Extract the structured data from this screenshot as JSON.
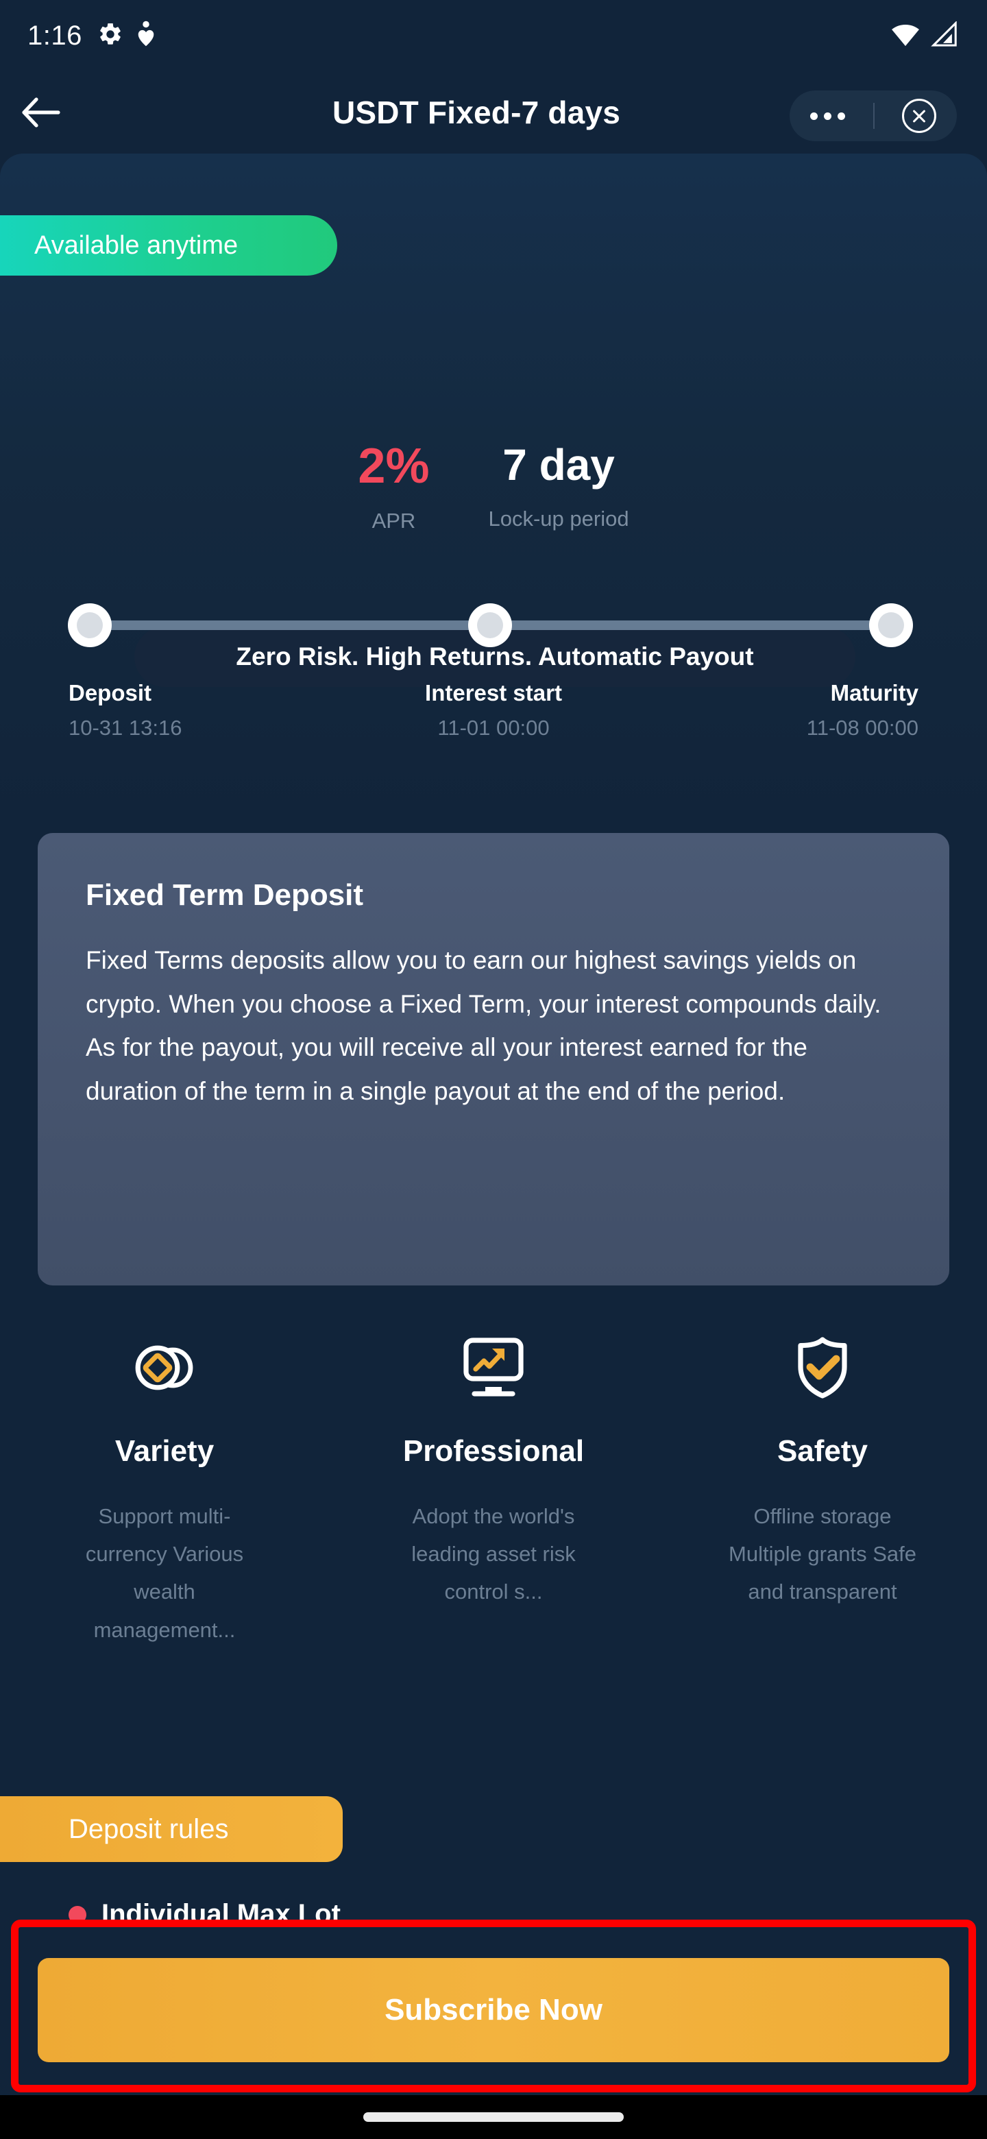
{
  "status_bar": {
    "time": "1:16",
    "left_icons": [
      "gear-icon",
      "location-heart-icon"
    ],
    "right_icons": [
      "wifi-icon",
      "cellular-signal-icon"
    ]
  },
  "app_bar": {
    "back_icon": "back-arrow-icon",
    "title": "USDT Fixed-7 days",
    "more_icon": "more-options-icon",
    "close_icon": "close-circle-icon"
  },
  "hero": {
    "availability_badge": "Available anytime",
    "apr_value": "2%",
    "apr_label": "APR",
    "days_value": "7 day",
    "days_label": "Lock-up period",
    "tagline": "Zero Risk. High Returns. Automatic Payout"
  },
  "timeline": {
    "steps": [
      {
        "name": "Deposit",
        "date": "10-31 13:16"
      },
      {
        "name": "Interest start",
        "date": "11-01 00:00"
      },
      {
        "name": "Maturity",
        "date": "11-08 00:00"
      }
    ]
  },
  "description_card": {
    "title": "Fixed Term Deposit",
    "body": "Fixed Terms deposits allow you to earn our highest savings yields on crypto. When you choose a Fixed Term, your interest compounds daily. As for the payout, you will receive all your interest earned for the duration of the term in a single payout at the end of the period."
  },
  "features": [
    {
      "icon": "coins-diamond-icon",
      "title": "Variety",
      "description": "Support multi-currency Various wealth management..."
    },
    {
      "icon": "monitor-trend-up-icon",
      "title": "Professional",
      "description": "Adopt the world's leading asset risk control s..."
    },
    {
      "icon": "shield-check-icon",
      "title": "Safety",
      "description": "Offline storage Multiple grants Safe and transparent"
    }
  ],
  "rules": {
    "badge_label": "Deposit rules",
    "first_item": "Individual Max Lot"
  },
  "bottom_bar": {
    "subscribe_label": "Subscribe Now"
  },
  "colors": {
    "background": "#11243a",
    "accent_orange": "#f0ad38",
    "accent_green": "#1ecf8e",
    "accent_red": "#f2495c",
    "card_grey": "#46546e",
    "highlight_border": "#ff0000"
  }
}
